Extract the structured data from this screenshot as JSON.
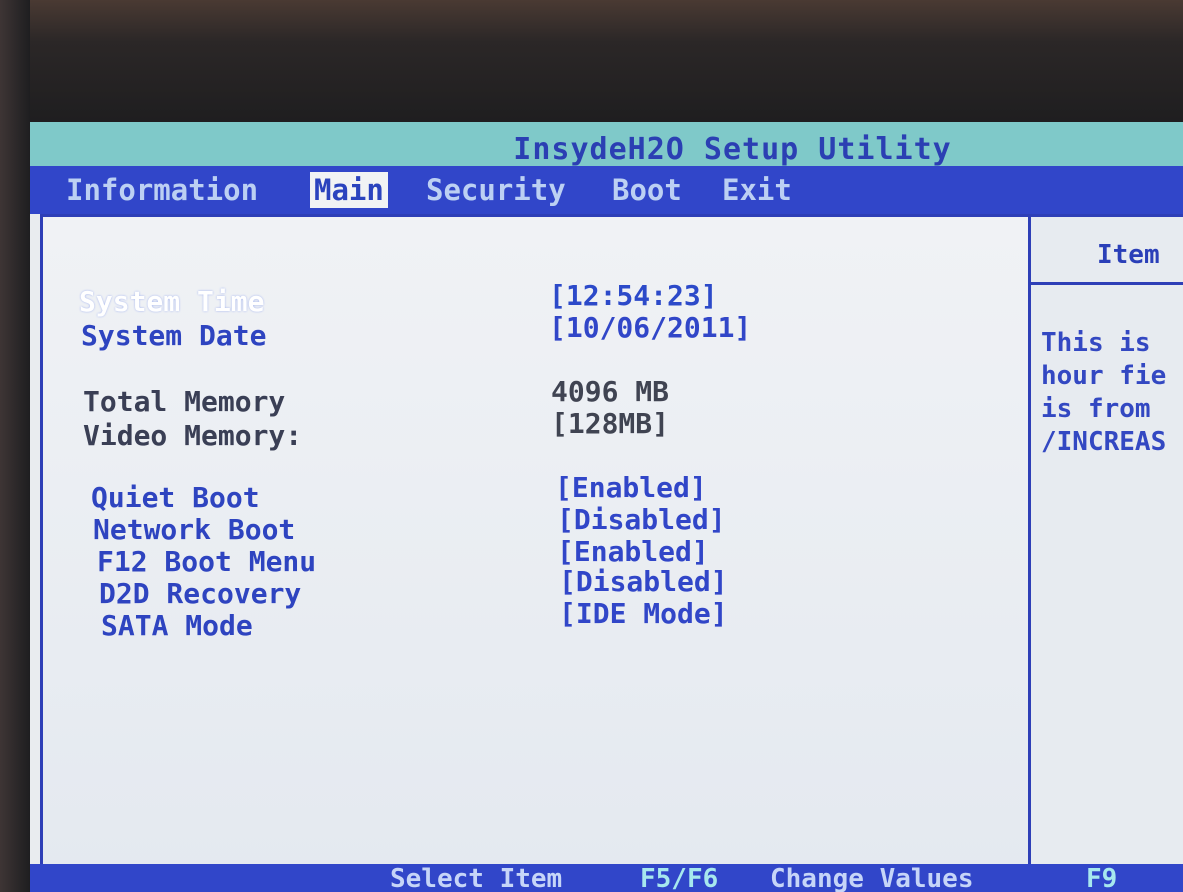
{
  "app": {
    "title": "InsydeH2O Setup Utility"
  },
  "menu": {
    "tabs": [
      {
        "label": "Information",
        "active": false
      },
      {
        "label": "Main",
        "active": true
      },
      {
        "label": "Security",
        "active": false
      },
      {
        "label": "Boot",
        "active": false
      },
      {
        "label": "Exit",
        "active": false
      }
    ]
  },
  "settings": {
    "system_time": {
      "label": "System Time",
      "value": "[12:54:23]"
    },
    "system_date": {
      "label": "System Date",
      "value": "[10/06/2011]"
    },
    "total_memory": {
      "label": "Total Memory",
      "value": "4096 MB"
    },
    "video_memory": {
      "label": "Video Memory:",
      "value": "[128MB]"
    },
    "quiet_boot": {
      "label": "Quiet Boot",
      "value": "[Enabled]"
    },
    "network_boot": {
      "label": "Network Boot",
      "value": "[Disabled]"
    },
    "f12_boot_menu": {
      "label": "F12 Boot Menu",
      "value": "[Enabled]"
    },
    "d2d_recovery": {
      "label": "D2D Recovery",
      "value": "[Disabled]"
    },
    "sata_mode": {
      "label": "SATA Mode",
      "value": "[IDE Mode]"
    }
  },
  "help": {
    "title": "Item",
    "text": "This is\nhour fie\nis from \n/INCREAS"
  },
  "footer": {
    "select_item_key": "Select Item",
    "f5f6_key": "F5/F6",
    "f5f6_desc": "Change Values",
    "f9_key": "F9"
  },
  "colors": {
    "title_bar_bg": "#7fc9c9",
    "menu_bar_bg": "#3146c9",
    "accent_blue": "#2e44c0",
    "screen_bg": "#e9ecef"
  }
}
